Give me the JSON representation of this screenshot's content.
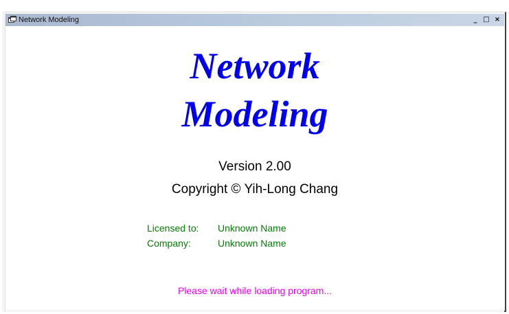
{
  "window": {
    "title": "Network Modeling",
    "controls": {
      "minimize": "_",
      "maximize": "□",
      "close": "×"
    }
  },
  "splash": {
    "logo_line1": "Network",
    "logo_line2": "Modeling",
    "logo_color": "#0000ee",
    "version": "Version 2.00",
    "copyright": "Copyright © Yih-Long Chang",
    "licensed_label": "Licensed to:",
    "licensed_value": "Unknown Name",
    "company_label": "Company:",
    "company_value": "Unknown Name",
    "license_color": "#008000",
    "loading_message": "Please wait while loading program...",
    "loading_color": "#ee00ee"
  },
  "icons": {
    "app": "app-window-icon"
  }
}
